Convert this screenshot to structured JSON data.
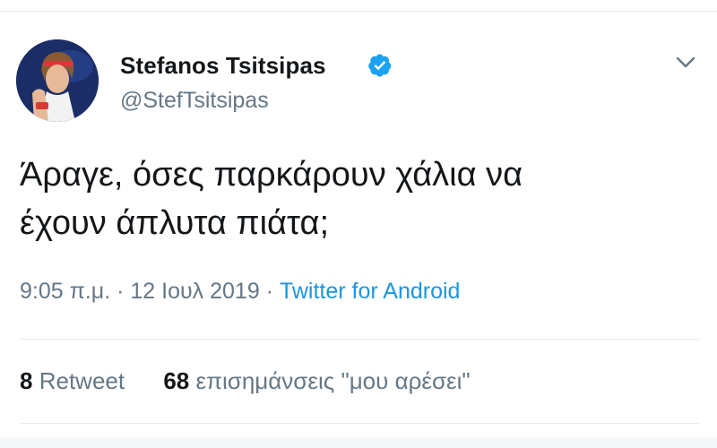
{
  "tweet": {
    "author": {
      "name": "Stefanos Tsitsipas",
      "handle": "@StefTsitsipas",
      "verified": true
    },
    "text_lines": [
      "Άραγε, όσες παρκάρουν χάλια να",
      "έχουν άπλυτα πιάτα;"
    ],
    "meta": {
      "time": "9:05 π.μ.",
      "separator": "·",
      "date": "12 Ιουλ 2019",
      "source": "Twitter for Android"
    },
    "stats": {
      "retweets_count": "8",
      "retweets_label": "Retweet",
      "likes_count": "68",
      "likes_label": "επισημάνσεις \"μου αρέσει\""
    }
  },
  "icons": {
    "verified": "verified-badge-icon",
    "menu": "chevron-down-icon"
  },
  "colors": {
    "text": "#14171a",
    "secondary": "#657786",
    "link": "#1b95e0",
    "verified": "#1da1f2",
    "divider": "#e6ecf0"
  }
}
